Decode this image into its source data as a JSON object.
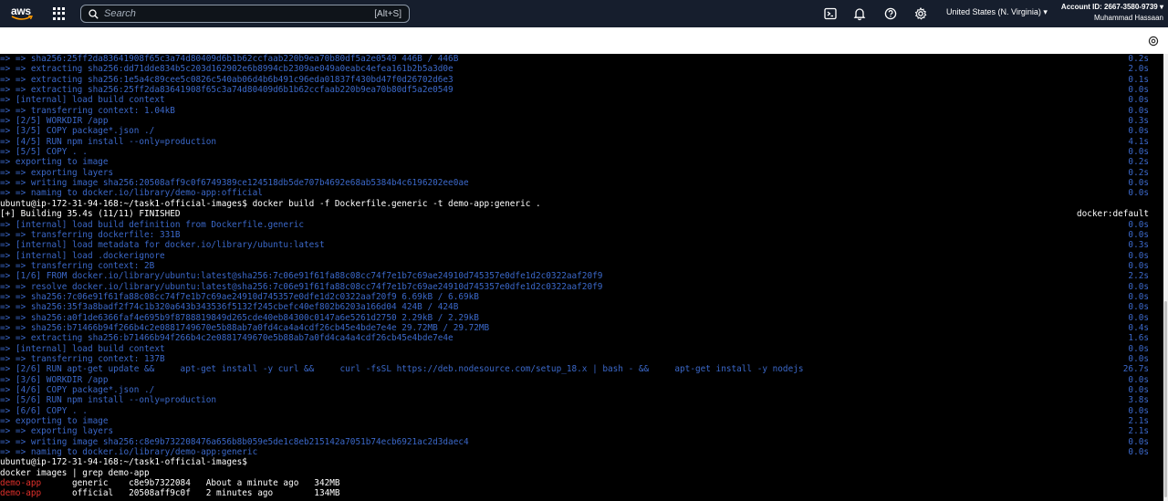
{
  "topnav": {
    "logo_text": "aws",
    "search_placeholder": "Search",
    "search_shortcut": "[Alt+S]",
    "icons": [
      "cloudshell-icon",
      "bell-icon",
      "help-icon",
      "gear-icon"
    ],
    "region": "United States (N. Virginia) ▾",
    "account_id": "Account ID: 2667-3580-9739 ▾",
    "user_name": "Muhammad Hassaan"
  },
  "terminal": {
    "lines": [
      {
        "t": "=> => sha256:25ff2da83641908f65c3a74d80409d6b1b62ccfaab220b9ea70b80df5a2e0549 446B / 446B",
        "r": "0.2s",
        "c": "blue"
      },
      {
        "t": "=> => extracting sha256:dd71dde834b5c203d162902e6b8994cb2309ae049a0eabc4efea161b2b5a3d0e",
        "r": "2.0s",
        "c": "blue"
      },
      {
        "t": "=> => extracting sha256:1e5a4c89cee5c0826c540ab06d4b6b491c96eda01837f430bd47f0d26702d6e3",
        "r": "0.1s",
        "c": "blue"
      },
      {
        "t": "=> => extracting sha256:25ff2da83641908f65c3a74d80409d6b1b62ccfaab220b9ea70b80df5a2e0549",
        "r": "0.0s",
        "c": "blue"
      },
      {
        "t": "=> [internal] load build context",
        "r": "0.0s",
        "c": "blue"
      },
      {
        "t": "=> => transferring context: 1.04kB",
        "r": "0.0s",
        "c": "blue"
      },
      {
        "t": "=> [2/5] WORKDIR /app",
        "r": "0.3s",
        "c": "blue"
      },
      {
        "t": "=> [3/5] COPY package*.json ./",
        "r": "0.0s",
        "c": "blue"
      },
      {
        "t": "=> [4/5] RUN npm install --only=production",
        "r": "4.1s",
        "c": "blue"
      },
      {
        "t": "=> [5/5] COPY . .",
        "r": "0.0s",
        "c": "blue"
      },
      {
        "t": "=> exporting to image",
        "r": "0.2s",
        "c": "blue"
      },
      {
        "t": "=> => exporting layers",
        "r": "0.2s",
        "c": "blue"
      },
      {
        "t": "=> => writing image sha256:20508aff9c0f6749389ce124518db5de707b4692e68ab5384b4c6196202ee0ae",
        "r": "0.0s",
        "c": "blue"
      },
      {
        "t": "=> => naming to docker.io/library/demo-app:official",
        "r": "0.0s",
        "c": "blue"
      },
      {
        "t": "ubuntu@ip-172-31-94-168:~/task1-official-images$ docker build -f Dockerfile.generic -t demo-app:generic .",
        "r": "",
        "c": "white"
      },
      {
        "t": "[+] Building 35.4s (11/11) FINISHED",
        "r": "docker:default",
        "c": "white"
      },
      {
        "t": "=> [internal] load build definition from Dockerfile.generic",
        "r": "0.0s",
        "c": "blue"
      },
      {
        "t": "=> => transferring dockerfile: 331B",
        "r": "0.0s",
        "c": "blue"
      },
      {
        "t": "=> [internal] load metadata for docker.io/library/ubuntu:latest",
        "r": "0.3s",
        "c": "blue"
      },
      {
        "t": "=> [internal] load .dockerignore",
        "r": "0.0s",
        "c": "blue"
      },
      {
        "t": "=> => transferring context: 2B",
        "r": "0.0s",
        "c": "blue"
      },
      {
        "t": "=> [1/6] FROM docker.io/library/ubuntu:latest@sha256:7c06e91f61fa88c08cc74f7e1b7c69ae24910d745357e0dfe1d2c0322aaf20f9",
        "r": "2.2s",
        "c": "blue"
      },
      {
        "t": "=> => resolve docker.io/library/ubuntu:latest@sha256:7c06e91f61fa88c08cc74f7e1b7c69ae24910d745357e0dfe1d2c0322aaf20f9",
        "r": "0.0s",
        "c": "blue"
      },
      {
        "t": "=> => sha256:7c06e91f61fa88c08cc74f7e1b7c69ae24910d745357e0dfe1d2c0322aaf20f9 6.69kB / 6.69kB",
        "r": "0.0s",
        "c": "blue"
      },
      {
        "t": "=> => sha256:35f3a8badf2f74c1b320a643b343536f5132f245cbefc40ef802b6203a166d04 424B / 424B",
        "r": "0.0s",
        "c": "blue"
      },
      {
        "t": "=> => sha256:a0f1de6366faf4e695b9f8788819849d265cde40eb84300c0147a6e5261d2750 2.29kB / 2.29kB",
        "r": "0.0s",
        "c": "blue"
      },
      {
        "t": "=> => sha256:b71466b94f266b4c2e0881749670e5b88ab7a0fd4ca4a4cdf26cb45e4bde7e4e 29.72MB / 29.72MB",
        "r": "0.4s",
        "c": "blue"
      },
      {
        "t": "=> => extracting sha256:b71466b94f266b4c2e0881749670e5b88ab7a0fd4ca4a4cdf26cb45e4bde7e4e",
        "r": "1.6s",
        "c": "blue"
      },
      {
        "t": "=> [internal] load build context",
        "r": "0.0s",
        "c": "blue"
      },
      {
        "t": "=> => transferring context: 137B",
        "r": "0.0s",
        "c": "blue"
      },
      {
        "t": "=> [2/6] RUN apt-get update &&     apt-get install -y curl &&     curl -fsSL https://deb.nodesource.com/setup_18.x | bash - &&     apt-get install -y nodejs",
        "r": "26.7s",
        "c": "blue"
      },
      {
        "t": "=> [3/6] WORKDIR /app",
        "r": "0.0s",
        "c": "blue"
      },
      {
        "t": "=> [4/6] COPY package*.json ./",
        "r": "0.0s",
        "c": "blue"
      },
      {
        "t": "=> [5/6] RUN npm install --only=production",
        "r": "3.8s",
        "c": "blue"
      },
      {
        "t": "=> [6/6] COPY . .",
        "r": "0.0s",
        "c": "blue"
      },
      {
        "t": "=> exporting to image",
        "r": "2.1s",
        "c": "blue"
      },
      {
        "t": "=> => exporting layers",
        "r": "2.1s",
        "c": "blue"
      },
      {
        "t": "=> => writing image sha256:c8e9b732208476a656b8b059e5de1c8eb215142a7051b74ecb6921ac2d3daec4",
        "r": "0.0s",
        "c": "blue"
      },
      {
        "t": "=> => naming to docker.io/library/demo-app:generic",
        "r": "0.0s",
        "c": "blue"
      },
      {
        "t": "ubuntu@ip-172-31-94-168:~/task1-official-images$",
        "r": "",
        "c": "white"
      },
      {
        "t": "docker images | grep demo-app",
        "r": "",
        "c": "white"
      }
    ],
    "image_rows": [
      {
        "name": "demo-app",
        "rest": "      generic    c8e9b7322084   About a minute ago   342MB"
      },
      {
        "name": "demo-app",
        "rest": "      official   20508aff9c0f   2 minutes ago        134MB"
      }
    ]
  }
}
